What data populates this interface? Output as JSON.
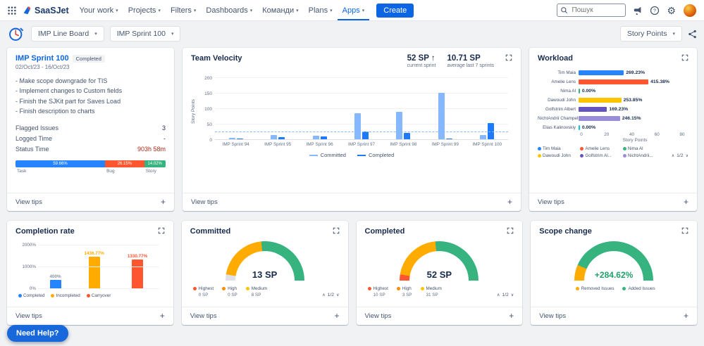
{
  "icons": {
    "chevron_down": "▾",
    "plus": "+",
    "gear": "⚙",
    "arrow_up": "↑",
    "pager_up": "∧",
    "pager_down": "∨"
  },
  "common": {
    "view_tips": "View tips"
  },
  "topnav": {
    "logo_text": "SaaSJet",
    "menu": [
      "Your work",
      "Projects",
      "Filters",
      "Dashboards",
      "Команди",
      "Plans",
      "Apps"
    ],
    "active_menu": "Apps",
    "create_label": "Create",
    "search_placeholder": "Пошук"
  },
  "toolbar": {
    "board_select": "IMP Line Board",
    "sprint_select": "IMP Sprint 100",
    "metric_select": "Story Points"
  },
  "sprint_card": {
    "title": "IMP Sprint 100",
    "badge": "Completed",
    "dates": "02/Oct/23 - 16/Oct/23",
    "notes": [
      "- Make scope downgrade for TIS",
      "- Implement changes to Custom fields",
      "- Finish the SJKit part for Saves Load",
      "- Finish description to charts"
    ],
    "stats": [
      {
        "label": "Flagged Issues",
        "value": "3"
      },
      {
        "label": "Logged Time",
        "value": "-"
      },
      {
        "label": "Status Time",
        "value": "903h 58m",
        "value_color": "#AE2A19"
      }
    ],
    "distribution": [
      {
        "label": "Task",
        "pct": "59.66%",
        "value": 59.66,
        "color": "#2684FF"
      },
      {
        "label": "Bug",
        "pct": "26.15%",
        "value": 26.15,
        "color": "#FF5630"
      },
      {
        "label": "Story",
        "pct": "14.02%",
        "value": 14.02,
        "color": "#36B37E"
      }
    ]
  },
  "velocity_card": {
    "title": "Team Velocity",
    "current_value": "52 SP",
    "current_label": "current sprint",
    "average_value": "10.71 SP",
    "average_label": "average last 7 sprints",
    "chart": {
      "type": "bar",
      "ylabel": "Story Points",
      "yticks": [
        0,
        50,
        100,
        150,
        200
      ],
      "ymax": 210,
      "categories": [
        "IMP Sprint 94",
        "IMP Sprint 95",
        "IMP Sprint 96",
        "IMP Sprint 97",
        "IMP Sprint 98",
        "IMP Sprint 99",
        "IMP Sprint 100"
      ],
      "series": [
        {
          "name": "Committed",
          "color": "#85B8FF",
          "values": [
            5,
            13,
            12,
            85,
            90,
            150,
            13
          ]
        },
        {
          "name": "Completed",
          "color": "#1D7AFC",
          "values": [
            2,
            8,
            10,
            25,
            20,
            3,
            52
          ]
        }
      ],
      "dashed_line_y": 25,
      "dashed_line_color": "#85B8FF"
    }
  },
  "workload_card": {
    "title": "Workload",
    "xlabel": "Story Points",
    "xticks": [
      0,
      20,
      40,
      60,
      80
    ],
    "xmax": 85,
    "bars": [
      {
        "name": "Tim Maia",
        "pct": "269.23%",
        "value": 35,
        "color": "#2684FF"
      },
      {
        "name": "Amelie Lens",
        "pct": "415.38%",
        "value": 54,
        "color": "#FF5630"
      },
      {
        "name": "Nima Al",
        "pct": "0.00%",
        "value": 0,
        "color": "#36B37E"
      },
      {
        "name": "Dawoudi John",
        "pct": "253.85%",
        "value": 33,
        "color": "#FFC400"
      },
      {
        "name": "Golfstrim Albert",
        "pct": "169.23%",
        "value": 22,
        "color": "#6554C0"
      },
      {
        "name": "NichtAndrii Champel",
        "pct": "246.15%",
        "value": 32,
        "color": "#998DD9"
      },
      {
        "name": "Elias Kalinovskiy",
        "pct": "0.00%",
        "value": 0,
        "color": "#00C7E6"
      }
    ],
    "legend": [
      {
        "label": "Tim Maia",
        "color": "#2684FF"
      },
      {
        "label": "Amelie Lens",
        "color": "#FF5630"
      },
      {
        "label": "Nima Al",
        "color": "#36B37E"
      },
      {
        "label": "Dawoudi John",
        "color": "#FFC400"
      },
      {
        "label": "Golfstrim Al...",
        "color": "#6554C0"
      },
      {
        "label": "NichtAndrii...",
        "color": "#998DD9"
      }
    ],
    "pagination": "1/2"
  },
  "completion_card": {
    "title": "Completion rate",
    "yticks": [
      0,
      1000,
      2000
    ],
    "ymax": 2000,
    "bars": [
      {
        "label": "Completed",
        "pct": "400%",
        "value": 400,
        "color": "#2684FF",
        "label_color": "#8993A4"
      },
      {
        "label": "Incompleted",
        "pct": "1436.77%",
        "value": 1436.77,
        "color": "#FFAB00",
        "label_color": "#FFAB00"
      },
      {
        "label": "Carryover",
        "pct": "1330.77%",
        "value": 1330.77,
        "color": "#FF5630",
        "label_color": "#FF5630"
      }
    ]
  },
  "committed_card": {
    "title": "Committed",
    "value": "13 SP",
    "segments": [
      {
        "color": "#DFE1E6",
        "frac": 0.05
      },
      {
        "color": "#FFAB00",
        "frac": 0.42
      },
      {
        "color": "#36B37E",
        "frac": 0.53
      }
    ],
    "legend": [
      {
        "label": "Highest",
        "value": "0 SP",
        "color": "#FF5630"
      },
      {
        "label": "High",
        "value": "0 SP",
        "color": "#FF8B00"
      },
      {
        "label": "Medium",
        "value": "8 SP",
        "color": "#FFC400"
      }
    ],
    "pagination": "1/2"
  },
  "completed_card": {
    "title": "Completed",
    "value": "52 SP",
    "segments": [
      {
        "color": "#FF5630",
        "frac": 0.05
      },
      {
        "color": "#FFAB00",
        "frac": 0.42
      },
      {
        "color": "#36B37E",
        "frac": 0.53
      }
    ],
    "legend": [
      {
        "label": "Highest",
        "value": "10 SP",
        "color": "#FF5630"
      },
      {
        "label": "High",
        "value": "3 SP",
        "color": "#FF8B00"
      },
      {
        "label": "Medium",
        "value": "31 SP",
        "color": "#FFC400"
      }
    ],
    "pagination": "1/2"
  },
  "scope_card": {
    "title": "Scope change",
    "value": "+284.62%",
    "segments": [
      {
        "color": "#FFAB00",
        "frac": 0.13
      },
      {
        "color": "#36B37E",
        "frac": 0.87
      }
    ],
    "legend": [
      {
        "label": "Removed Issues",
        "color": "#FFAB00"
      },
      {
        "label": "Added Issues",
        "color": "#36B37E"
      }
    ]
  },
  "help_button": "Need Help?"
}
